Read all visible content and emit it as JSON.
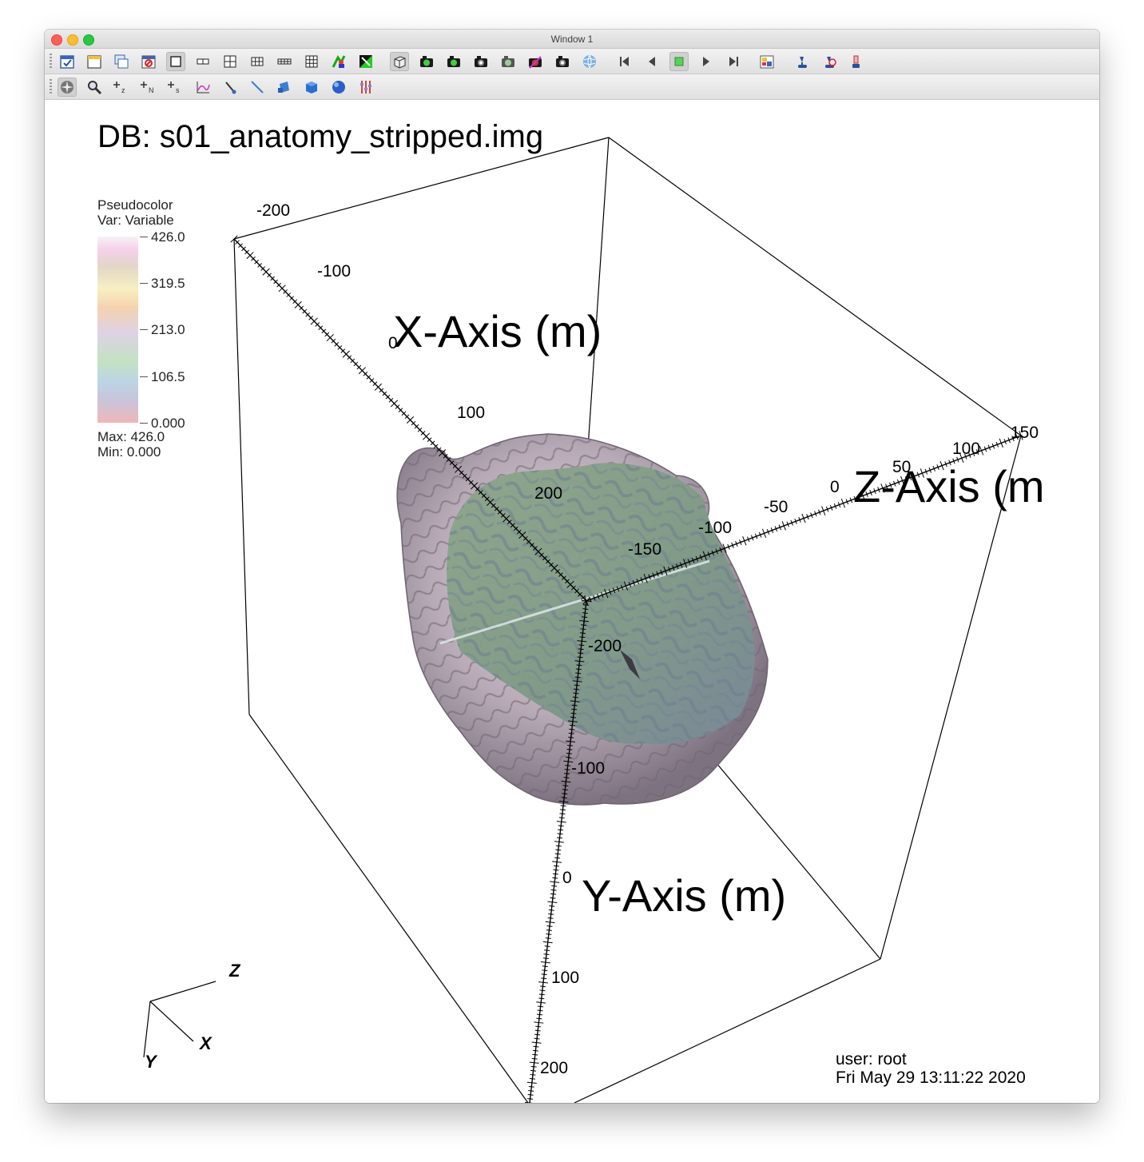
{
  "window": {
    "title": "Window 1"
  },
  "toolbar1": {
    "buttons": [
      {
        "name": "active-window-check-button",
        "icon": "checkbox-icon",
        "active": false
      },
      {
        "name": "new-window-button",
        "icon": "window-icon",
        "active": false
      },
      {
        "name": "clone-window-button",
        "icon": "clone-window-icon",
        "active": false
      },
      {
        "name": "delete-window-button",
        "icon": "delete-window-icon",
        "active": false
      },
      {
        "name": "layout-1x1-button",
        "icon": "layout-1x1-icon",
        "active": true
      },
      {
        "name": "layout-1x2-button",
        "icon": "layout-1x2-icon",
        "active": false
      },
      {
        "name": "layout-2x2-button",
        "icon": "layout-2x2-icon",
        "active": false
      },
      {
        "name": "layout-2x3-button",
        "icon": "layout-2x3-icon",
        "active": false
      },
      {
        "name": "layout-2x4-button",
        "icon": "layout-2x4-icon",
        "active": false
      },
      {
        "name": "layout-3x3-button",
        "icon": "layout-3x3-icon",
        "active": false
      },
      {
        "name": "lock-view-button",
        "icon": "lock-view-icon",
        "active": false
      },
      {
        "name": "lock-time-button",
        "icon": "lock-time-icon",
        "active": false
      },
      {
        "name": "view-3d-button",
        "icon": "cube-outline-icon",
        "active": true
      },
      {
        "name": "recenter-view-button",
        "icon": "camera-green-icon",
        "active": false
      },
      {
        "name": "undo-view-button",
        "icon": "camera-green-icon",
        "active": false
      },
      {
        "name": "redo-view-button",
        "icon": "camera-icon",
        "active": false
      },
      {
        "name": "save-view-button",
        "icon": "camera-gray-icon",
        "active": false
      },
      {
        "name": "choose-center-button",
        "icon": "camera-red-icon",
        "active": false
      },
      {
        "name": "reset-view-button",
        "icon": "camera-icon",
        "active": false
      },
      {
        "name": "spin-mode-button",
        "icon": "globe-icon",
        "active": false
      },
      {
        "name": "first-frame-button",
        "icon": "skip-back-icon",
        "active": false
      },
      {
        "name": "prev-frame-button",
        "icon": "step-back-icon",
        "active": false
      },
      {
        "name": "stop-button",
        "icon": "stop-icon",
        "active": true
      },
      {
        "name": "play-button",
        "icon": "play-icon",
        "active": false
      },
      {
        "name": "last-frame-button",
        "icon": "skip-forward-icon",
        "active": false
      },
      {
        "name": "invert-background-button",
        "icon": "image-palette-icon",
        "active": false
      },
      {
        "name": "lighting-button",
        "icon": "lamp-icon",
        "active": false
      },
      {
        "name": "lighting-off-button",
        "icon": "lamp-off-icon",
        "active": false
      },
      {
        "name": "engine-button",
        "icon": "beaker-icon",
        "active": false
      }
    ]
  },
  "toolbar2": {
    "buttons": [
      {
        "name": "navigate-mode-button",
        "icon": "compass-icon",
        "active": true
      },
      {
        "name": "zoom-mode-button",
        "icon": "magnifier-icon",
        "active": false
      },
      {
        "name": "zone-pick-button",
        "icon": "pick-z-icon",
        "active": false
      },
      {
        "name": "node-pick-button",
        "icon": "pick-n-icon",
        "active": false
      },
      {
        "name": "spreadsheet-pick-button",
        "icon": "pick-s-icon",
        "active": false
      },
      {
        "name": "curve-pick-button",
        "icon": "curve-icon",
        "active": false
      },
      {
        "name": "point-tool-button",
        "icon": "point-tool-icon",
        "active": false
      },
      {
        "name": "line-tool-button",
        "icon": "line-tool-icon",
        "active": false
      },
      {
        "name": "plane-tool-button",
        "icon": "plane-icon",
        "active": false
      },
      {
        "name": "box-tool-button",
        "icon": "box-icon",
        "active": false
      },
      {
        "name": "sphere-tool-button",
        "icon": "sphere-icon",
        "active": false
      },
      {
        "name": "axis-restriction-button",
        "icon": "sliders-icon",
        "active": false
      }
    ]
  },
  "plot": {
    "db_title": "DB: s01_anatomy_stripped.img",
    "legend": {
      "title": "Pseudocolor",
      "var": "Var: Variable",
      "labels": [
        "426.0",
        "319.5",
        "213.0",
        "106.5",
        "0.000"
      ],
      "max": "Max:  426.0",
      "min": "Min:  0.000"
    },
    "axes": {
      "x_title": "X-Axis (m)",
      "y_title": "Y-Axis (m)",
      "z_title": "Z-Axis (m",
      "x_ticks": [
        "-200",
        "-100",
        "0",
        "100",
        "200"
      ],
      "y_ticks": [
        "-200",
        "-100",
        "0",
        "100",
        "200"
      ],
      "z_ticks": [
        "-150",
        "-100",
        "-50",
        "0",
        "50",
        "100",
        "150"
      ]
    },
    "triad": {
      "x": "X",
      "y": "Y",
      "z": "Z"
    },
    "user": "user: root",
    "date": "Fri May 29 13:11:22 2020"
  }
}
